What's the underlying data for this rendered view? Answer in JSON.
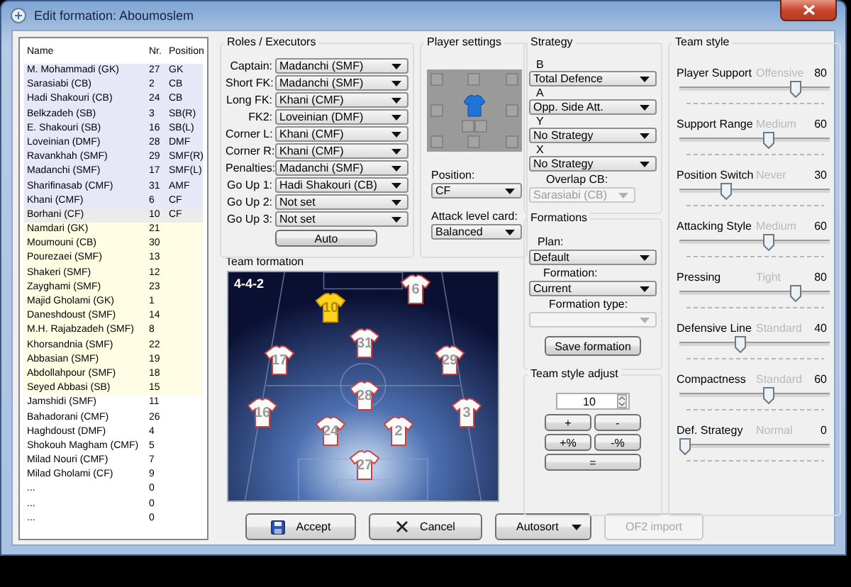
{
  "window": {
    "title": "Edit formation: Aboumoslem"
  },
  "player_list": {
    "columns": [
      "Name",
      "Nr.",
      "Position"
    ],
    "rows": [
      {
        "name": "M. Mohammadi (GK)",
        "number": "27",
        "position": "GK",
        "kind": "starter",
        "selected": false
      },
      {
        "name": "Sarasiabi (CB)",
        "number": "2",
        "position": "CB",
        "kind": "starter",
        "selected": false
      },
      {
        "name": "Hadi Shakouri (CB)",
        "number": "24",
        "position": "CB",
        "kind": "starter",
        "selected": false
      },
      {
        "name": "Belkzadeh (SB)",
        "number": "3",
        "position": "SB(R)",
        "kind": "starter",
        "selected": false
      },
      {
        "name": "E. Shakouri (SB)",
        "number": "16",
        "position": "SB(L)",
        "kind": "starter",
        "selected": false
      },
      {
        "name": "Loveinian (DMF)",
        "number": "28",
        "position": "DMF",
        "kind": "starter",
        "selected": false
      },
      {
        "name": "Ravankhah (SMF)",
        "number": "29",
        "position": "SMF(R)",
        "kind": "starter",
        "selected": false
      },
      {
        "name": "Madanchi (SMF)",
        "number": "17",
        "position": "SMF(L)",
        "kind": "starter",
        "selected": false
      },
      {
        "name": "Sharifinasab (CMF)",
        "number": "31",
        "position": "AMF",
        "kind": "starter",
        "selected": false
      },
      {
        "name": "Khani (CMF)",
        "number": "6",
        "position": "CF",
        "kind": "starter",
        "selected": false
      },
      {
        "name": "Borhani (CF)",
        "number": "10",
        "position": "CF",
        "kind": "starter",
        "selected": true
      },
      {
        "name": "Namdari (GK)",
        "number": "21",
        "kind": "sub",
        "selected": false
      },
      {
        "name": "Moumouni (CB)",
        "number": "30",
        "kind": "sub",
        "selected": false
      },
      {
        "name": "Pourezaei (SMF)",
        "number": "13",
        "kind": "sub",
        "selected": false
      },
      {
        "name": "Shakeri (SMF)",
        "number": "12",
        "kind": "sub",
        "selected": false
      },
      {
        "name": "Zayghami (SMF)",
        "number": "23",
        "kind": "sub",
        "selected": false
      },
      {
        "name": "Majid Gholami (GK)",
        "number": "1",
        "kind": "sub",
        "selected": false
      },
      {
        "name": "Daneshdoust (SMF)",
        "number": "14",
        "kind": "sub",
        "selected": false
      },
      {
        "name": "M.H. Rajabzadeh (SMF)",
        "number": "8",
        "kind": "sub",
        "selected": false
      },
      {
        "name": "Khorsandnia (SMF)",
        "number": "22",
        "kind": "sub",
        "selected": false
      },
      {
        "name": "Abbasian (SMF)",
        "number": "19",
        "kind": "sub",
        "selected": false
      },
      {
        "name": "Abdollahpour (SMF)",
        "number": "18",
        "kind": "sub",
        "selected": false
      },
      {
        "name": "Seyed Abbasi (SB)",
        "number": "15",
        "kind": "sub",
        "selected": false
      },
      {
        "name": "Jamshidi (SMF)",
        "number": "11",
        "kind": "reserve",
        "selected": false
      },
      {
        "name": "Bahadorani (CMF)",
        "number": "26",
        "kind": "reserve",
        "selected": false
      },
      {
        "name": "Haghdoust (DMF)",
        "number": "4",
        "kind": "reserve",
        "selected": false
      },
      {
        "name": "Shokouh Magham (CMF)",
        "number": "5",
        "kind": "reserve",
        "selected": false
      },
      {
        "name": "Milad Nouri (CMF)",
        "number": "7",
        "kind": "reserve",
        "selected": false
      },
      {
        "name": "Milad Gholami (CF)",
        "number": "9",
        "kind": "reserve",
        "selected": false
      },
      {
        "name": "...",
        "number": "0",
        "kind": "reserve",
        "selected": false
      },
      {
        "name": "...",
        "number": "0",
        "kind": "reserve",
        "selected": false
      },
      {
        "name": "...",
        "number": "0",
        "kind": "reserve",
        "selected": false
      }
    ]
  },
  "roles": {
    "title": "Roles / Executors",
    "rows": [
      {
        "label": "Captain:",
        "value": "Madanchi (SMF)"
      },
      {
        "label": "Short FK:",
        "value": "Madanchi (SMF)"
      },
      {
        "label": "Long FK:",
        "value": "Khani (CMF)"
      },
      {
        "label": "FK2:",
        "value": "Loveinian (DMF)"
      },
      {
        "label": "Corner L:",
        "value": "Khani (CMF)"
      },
      {
        "label": "Corner R:",
        "value": "Khani (CMF)"
      },
      {
        "label": "Penalties:",
        "value": "Madanchi (SMF)"
      },
      {
        "label": "Go Up 1:",
        "value": "Hadi Shakouri (CB)"
      },
      {
        "label": "Go Up 2:",
        "value": "Not set"
      },
      {
        "label": "Go Up 3:",
        "value": "Not set"
      }
    ],
    "button": "Auto"
  },
  "player_settings": {
    "title": "Player settings",
    "position_label": "Position:",
    "position": "CF",
    "attack_label": "Attack level card:",
    "attack": "Balanced"
  },
  "team_formation": {
    "title": "Team formation",
    "formation": "4-4-2",
    "players": [
      {
        "number": "10",
        "selected": true
      },
      {
        "number": "6",
        "selected": false
      },
      {
        "number": "31",
        "selected": false
      },
      {
        "number": "17",
        "selected": false
      },
      {
        "number": "29",
        "selected": false
      },
      {
        "number": "28",
        "selected": false
      },
      {
        "number": "16",
        "selected": false
      },
      {
        "number": "24",
        "selected": false
      },
      {
        "number": "2",
        "selected": false
      },
      {
        "number": "3",
        "selected": false
      },
      {
        "number": "27",
        "selected": false
      }
    ]
  },
  "strategy": {
    "title": "Strategy",
    "fields": [
      {
        "label": "B",
        "value": "Total Defence",
        "disabled": false
      },
      {
        "label": "A",
        "value": "Opp. Side Att.",
        "disabled": false
      },
      {
        "label": "Y",
        "value": "No Strategy",
        "disabled": false
      },
      {
        "label": "X",
        "value": "No Strategy",
        "disabled": false
      },
      {
        "label": "Overlap CB:",
        "value": "Sarasiabi (CB)",
        "disabled": true
      }
    ]
  },
  "formations": {
    "title": "Formations",
    "fields": [
      {
        "label": "Plan:",
        "value": "Default",
        "disabled": false
      },
      {
        "label": "Formation:",
        "value": "Current",
        "disabled": false
      },
      {
        "label": "Formation type:",
        "disabled": true
      }
    ],
    "button": "Save formation"
  },
  "team_style_adjust": {
    "title": "Team style adjust",
    "value": "10",
    "buttons": [
      "+",
      "-",
      "+%",
      "-%",
      "="
    ]
  },
  "team_style": {
    "title": "Team style",
    "sliders": [
      {
        "label": "Player Support",
        "hint": "Offensive",
        "value": "80",
        "level": 0.8
      },
      {
        "label": "Support Range",
        "hint": "Medium",
        "value": "60",
        "level": 0.6
      },
      {
        "label": "Position Switch",
        "hint": "Never",
        "value": "30",
        "level": 0.3
      },
      {
        "label": "Attacking Style",
        "hint": "Medium",
        "value": "60",
        "level": 0.6
      },
      {
        "label": "Pressing",
        "hint": "Tight",
        "value": "80",
        "level": 0.8
      },
      {
        "label": "Defensive Line",
        "hint": "Standard",
        "value": "40",
        "level": 0.4
      },
      {
        "label": "Compactness",
        "hint": "Standard",
        "value": "60",
        "level": 0.6
      },
      {
        "label": "Def. Strategy",
        "hint": "Normal",
        "value": "0",
        "level": 0
      }
    ]
  },
  "buttons": [
    {
      "label": "Accept",
      "kind": "accept",
      "disabled": false
    },
    {
      "label": "Cancel",
      "kind": "cancel",
      "disabled": false
    },
    {
      "label": "Autosort",
      "kind": "menu",
      "disabled": false
    },
    {
      "label": "OF2 import",
      "kind": "plain",
      "disabled": true
    }
  ]
}
